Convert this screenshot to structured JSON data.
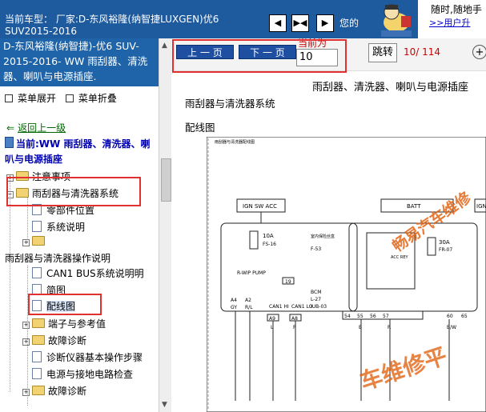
{
  "header": {
    "car_label": "当前车型：  厂家:D-东风裕隆(纳智捷LUXGEN)优6 SUV2015-2016",
    "nav_buttons": [
      "◀",
      "▶◀",
      "▶"
    ],
    "welcome": "您的",
    "promo_line1": "随时,随地手",
    "promo_line2": ">>用户升"
  },
  "sidebar": {
    "doc_title": "D-东风裕隆(纳智捷)-优6 SUV-2015-2016- WW 雨刮器、清洗器、喇叭与电源插座.",
    "expand": "菜单展开",
    "collapse": "菜单折叠",
    "back": "返回上一级",
    "current": "当前:WW 雨刮器、清洗器、喇叭与电源插座",
    "tree": [
      {
        "label": "注意事项"
      },
      {
        "label": "雨刮器与清洗器系统"
      },
      {
        "label": "零部件位置"
      },
      {
        "label": "系统说明"
      },
      {
        "label": ""
      },
      {
        "label": "雨刮器与清洗器操作说明"
      },
      {
        "label": "CAN1 BUS系统说明明"
      },
      {
        "label": "简图"
      },
      {
        "label": "配线图"
      },
      {
        "label": "端子与参考值"
      },
      {
        "label": "故障诊断"
      },
      {
        "label": "诊断仪器基本操作步骤"
      },
      {
        "label": "电源与接地电路检查"
      },
      {
        "label": "故障诊断"
      }
    ]
  },
  "viewer": {
    "prev": "上 一 页",
    "next": "下 一 页",
    "current_label": "当前为",
    "page_value": "10",
    "jump": "跳转",
    "page_count": "10/ 114",
    "zoom": "+",
    "doc_header": "雨刮器、清洗器、喇叭与电源插座",
    "section_title": "雨刮器与清洗器系统",
    "wiring_label": "配线图"
  },
  "diagram": {
    "title": "雨刮器与清洗器配线图",
    "ign_sw": "IGN SW ACC",
    "batt": "BATT",
    "ign_right": "IGN",
    "fuse1_amp": "10A",
    "fuse1_id": "FS-16",
    "fuse2_amp": "30A",
    "fuse2_id": "FR-07",
    "fs_box": "室内保险丝盒",
    "fs_conn": "F-53",
    "relay_label": "ACC\nREY",
    "wiper_pump": "R-WIP\nPUMP",
    "pump_pin": "19",
    "bcm": "BCM",
    "bcm_conn": "L-27",
    "bcm_conn2": "IUB-03",
    "can_hi": "CAN1\nHI",
    "can_lo": "CAN1\nLO",
    "pin_a9": "A9",
    "pin_a8": "A8",
    "pin_a4": "A4",
    "pin_a2": "A2",
    "pins_top": [
      "54",
      "55",
      "56",
      "57",
      "60",
      "65"
    ],
    "wire_gy": "GY",
    "wire_rl": "R/L",
    "wire_l": "L",
    "wire_p": "P",
    "wire_b": "B",
    "wire_r": "R",
    "wire_bw": "B/W",
    "watermark": "畅易汽车维修",
    "watermark2": "车维修平"
  },
  "colors": {
    "topbar_bg": "#1e5a9e",
    "title_bg": "#1f63a8",
    "page_btn": "#1f4fa0",
    "highlight_red": "#e03030",
    "watermark": "#e16414"
  },
  "icons": {
    "expand": "menu-expand-icon",
    "collapse": "menu-collapse-icon",
    "back": "back-arrow-icon",
    "current": "book-icon",
    "folder": "folder-icon",
    "page": "page-icon"
  }
}
